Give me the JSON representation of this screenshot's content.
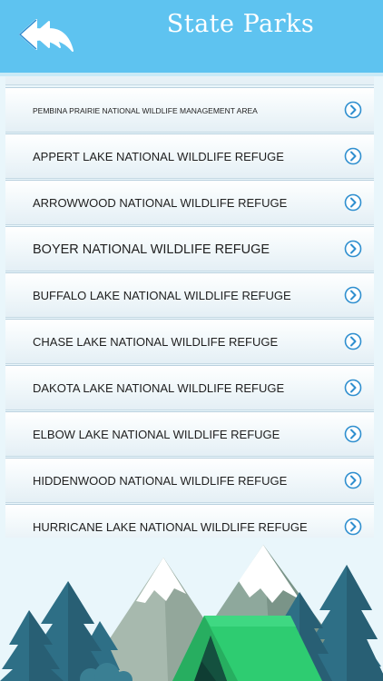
{
  "header": {
    "title": "State Parks",
    "back_icon": "double-back-arrow-icon"
  },
  "list": {
    "chevron_icon": "chevron-right-circle-icon",
    "items": [
      {
        "label": ""
      },
      {
        "label": "PEMBINA PRAIRIE NATIONAL WILDLIFE MANAGEMENT AREA"
      },
      {
        "label": "APPERT LAKE NATIONAL WILDLIFE REFUGE"
      },
      {
        "label": "ARROWWOOD NATIONAL WILDLIFE REFUGE"
      },
      {
        "label": "BOYER NATIONAL WILDLIFE REFUGE"
      },
      {
        "label": "BUFFALO LAKE NATIONAL WILDLIFE REFUGE"
      },
      {
        "label": "CHASE LAKE NATIONAL WILDLIFE REFUGE"
      },
      {
        "label": "DAKOTA LAKE NATIONAL WILDLIFE REFUGE"
      },
      {
        "label": "ELBOW LAKE NATIONAL WILDLIFE REFUGE"
      },
      {
        "label": "HIDDENWOOD NATIONAL WILDLIFE REFUGE"
      },
      {
        "label": "HURRICANE LAKE NATIONAL WILDLIFE REFUGE"
      }
    ]
  },
  "colors": {
    "header": "#5ec3f0",
    "background": "#e9f6fb",
    "chevron": "#2f8fcf",
    "tent": "#2ecc71",
    "mountain": "#9fb2a8",
    "tree": "#2e6f86"
  }
}
